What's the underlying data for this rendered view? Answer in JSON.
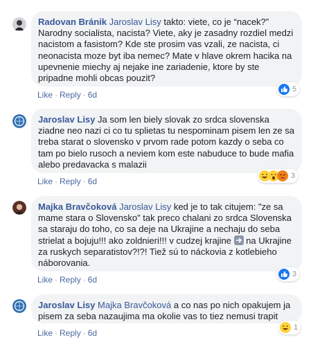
{
  "comments": [
    {
      "author": "Radovan Bránik",
      "mention": "Jaroslav Lisy",
      "text": " takto: viete, co je “nacek?” Narodny socialista, nacista? Viete, aky je zasadny rozdiel medzi nacistom a fasistom? Kde ste prosim vas vzali, ze nacista, ci neonacista moze byt iba nemec? Mate v hlave okrem hacika na upevnenie miechy aj nejake ine zariadenie, ktore by ste pripadne mohli obcas pouzit?",
      "text_after": "",
      "like_label": "Like",
      "reply_label": "Reply",
      "time": "6d",
      "reaction_count": "5",
      "reaction_types": [
        "like"
      ]
    },
    {
      "author": "Jaroslav Lisy",
      "mention": "",
      "text": " Ja som len biely slovak zo srdca slovenska ziadne neo nazi ci co tu splietas tu nespominam pisem len ze sa treba starat o slovensko v prvom rade potom kazdy o seba co tam po bielo rusoch a neviem kom este nabuduce to bude mafia alebo predavacka s malazii",
      "text_after": "",
      "like_label": "Like",
      "reply_label": "Reply",
      "time": "6d",
      "reaction_count": "3",
      "reaction_types": [
        "haha",
        "wow",
        "angry"
      ]
    },
    {
      "author": "Majka Bravčoková",
      "mention": "Jaroslav Lisy",
      "text": " ked je to tak citujem: \"ze sa mame stara o Slovensko\" tak preco chalani zo srdca Slovenska sa staraju do toho, co sa deje na Ukrajine a nechaju do seba strielat a bojuju!!! ako zoldnieri!!! v cudzej krajine",
      "text_after": " na Ukrajine za ruskych separatistov?!?! Tiež sú to náckovia z kotlebieho náborovania.",
      "like_label": "Like",
      "reply_label": "Reply",
      "time": "6d",
      "reaction_count": "3",
      "reaction_types": [
        "like"
      ]
    },
    {
      "author": "Jaroslav Lisy",
      "mention": "Majka Bravčoková",
      "text": " a co nas po nich opakujem ja pisem za seba nazaujima ma okolie vas to tiez nemusi trapit",
      "text_after": "",
      "like_label": "Like",
      "reply_label": "Reply",
      "time": "6d",
      "reaction_count": "1",
      "reaction_types": [
        "haha"
      ]
    }
  ],
  "inline_emoji_icon": "right-arrow-emoji-icon",
  "colors": {
    "link": "#385898",
    "bubble": "#f2f3f5",
    "meta": "#90949c",
    "like_blue": "#1877f2"
  }
}
